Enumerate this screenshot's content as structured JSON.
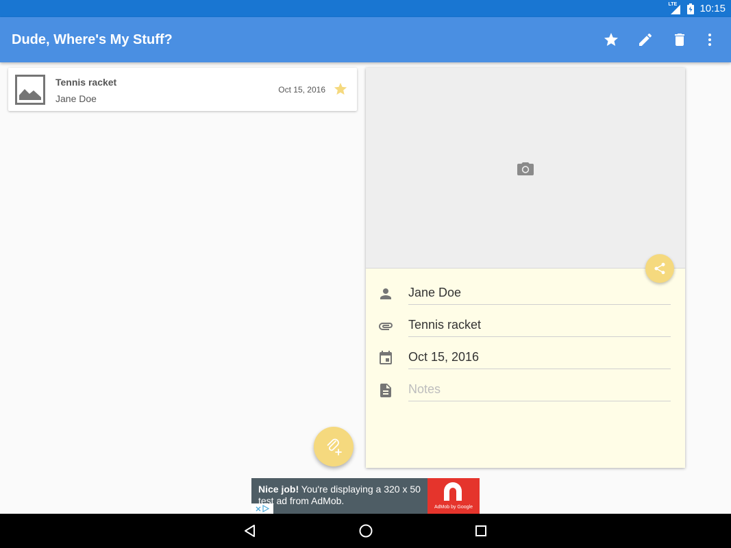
{
  "status_bar": {
    "time": "10:15",
    "network_label": "LTE"
  },
  "app_bar": {
    "title": "Dude, Where's My Stuff?",
    "actions": [
      {
        "name": "favorite",
        "icon": "star-icon"
      },
      {
        "name": "edit",
        "icon": "pencil-icon"
      },
      {
        "name": "delete",
        "icon": "trash-icon"
      },
      {
        "name": "overflow",
        "icon": "more-vert-icon"
      }
    ]
  },
  "list": {
    "items": [
      {
        "name": "Tennis racket",
        "person": "Jane Doe",
        "date": "Oct 15, 2016",
        "starred": true
      }
    ]
  },
  "detail": {
    "photo_icon": "camera-icon",
    "share_icon": "share-icon",
    "fields": {
      "person": {
        "value": "Jane Doe",
        "icon": "person-icon"
      },
      "item": {
        "value": "Tennis racket",
        "icon": "paperclip-icon"
      },
      "date": {
        "value": "Oct 15, 2016",
        "icon": "calendar-icon"
      },
      "notes": {
        "value": "",
        "placeholder": "Notes",
        "icon": "document-icon"
      }
    }
  },
  "fab": {
    "icon": "attach-add-icon"
  },
  "ad": {
    "bold": "Nice job!",
    "text": " You're displaying a 320 x 50 test ad from AdMob.",
    "logo_caption": "AdMob by Google"
  },
  "colors": {
    "status_bar": "#1976d2",
    "app_bar": "#4a8fe2",
    "accent": "#f5d97e",
    "star": "#f5d97e",
    "detail_background": "#fffde7",
    "ad_red": "#e5342c"
  }
}
